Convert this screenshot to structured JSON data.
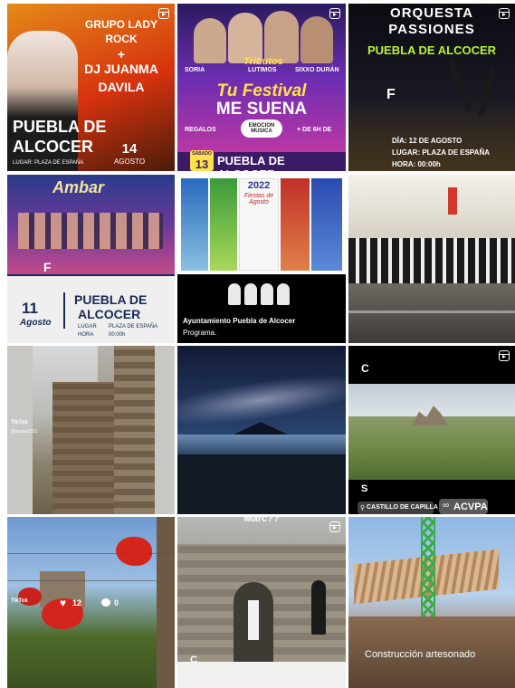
{
  "tiles": {
    "t1": {
      "line1": "GRUPO LADY",
      "line2": "ROCK",
      "plus": "+",
      "line3": "DJ JUANMA",
      "line4": "DAVILA",
      "town1": "PUEBLA DE",
      "town2": "ALCOCER",
      "day": "14",
      "month": "AGOSTO",
      "place": "LUGAR: PLAZA DE ESPAÑA"
    },
    "t2": {
      "top_title": "Tributos",
      "title1": "Tu Festival",
      "title2": "ME SUENA",
      "sub": "EMOCION MUSICA",
      "left_note": "REGALOS",
      "right_note": "+ DE 6H DE",
      "day_label": "SÁBADO",
      "day": "13",
      "town": "PUEBLA DE ALCOCER",
      "names": [
        "SORIA",
        "LUTIMOS",
        "SIXXO DURÁN"
      ]
    },
    "t3": {
      "title1": "ORQUESTA",
      "title2": "PASSIONES",
      "town": "PUEBLA DE ALCOCER",
      "date": "DÍA: 12 DE AGOSTO",
      "place": "LUGAR: PLAZA DE ESPAÑA",
      "time": "HORA: 00:00h",
      "letter": "F"
    },
    "t4": {
      "band": "Ambar",
      "letter": "F",
      "day": "11",
      "month": "Agosto",
      "town1": "PUEBLA DE",
      "town2": "ALCOCER",
      "lugar_label": "LUGAR",
      "lugar_val": "PLAZA DE ESPAÑA",
      "hora_label": "HORA",
      "hora_val": "00:00h"
    },
    "t5": {
      "year": "2022",
      "fiestas": "Fiestas de Agosto",
      "account": "Ayuntamiento Puebla de Alcocer",
      "caption": "Programa."
    },
    "t7": {
      "tiktok": "TikTok",
      "handle": "@acvpa2021"
    },
    "t9": {
      "letter_top": "C",
      "letter_bottom": "S",
      "location_tag": "CASTILLO DE CAPILLA",
      "mention_tag": "ACVPA"
    },
    "t10": {
      "tiktok": "TikTok",
      "likes": "12",
      "comments": "0"
    },
    "t11": {
      "top_text": "Marc??",
      "letter": "C"
    },
    "t12": {
      "caption": "Construcción artesonado"
    }
  },
  "icons": {
    "reel": "reels-icon",
    "heart": "heart-icon",
    "comment": "comment-icon",
    "pin": "location-pin-icon",
    "link": "link-icon"
  },
  "colors": {
    "accent_yellow": "#f3d31a",
    "accent_green": "#b7f23a",
    "white": "#ffffff"
  }
}
